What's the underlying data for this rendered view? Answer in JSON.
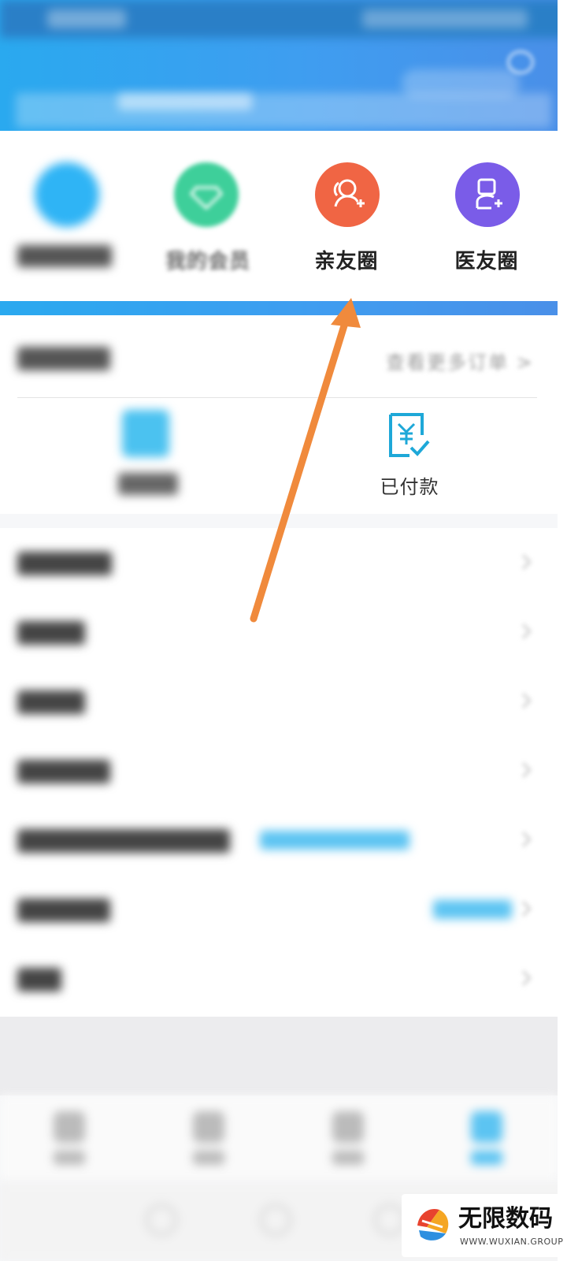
{
  "quick_actions": [
    {
      "label": "",
      "color": "#2fb4f5"
    },
    {
      "label": "我的会员",
      "color": "#3ecf9a"
    },
    {
      "label": "亲友圈",
      "color": "#f06544"
    },
    {
      "label": "医友圈",
      "color": "#7a5ce8"
    }
  ],
  "orders": {
    "more_label": "查看更多订单 >",
    "paid_label": "已付款"
  },
  "watermark": {
    "title": "无限数码",
    "url": "WWW.WUXIAN.GROUP"
  },
  "colors": {
    "header_blue": "#2aa9ef",
    "arrow_orange": "#f08a3c",
    "paid_icon": "#1ea8d8"
  }
}
